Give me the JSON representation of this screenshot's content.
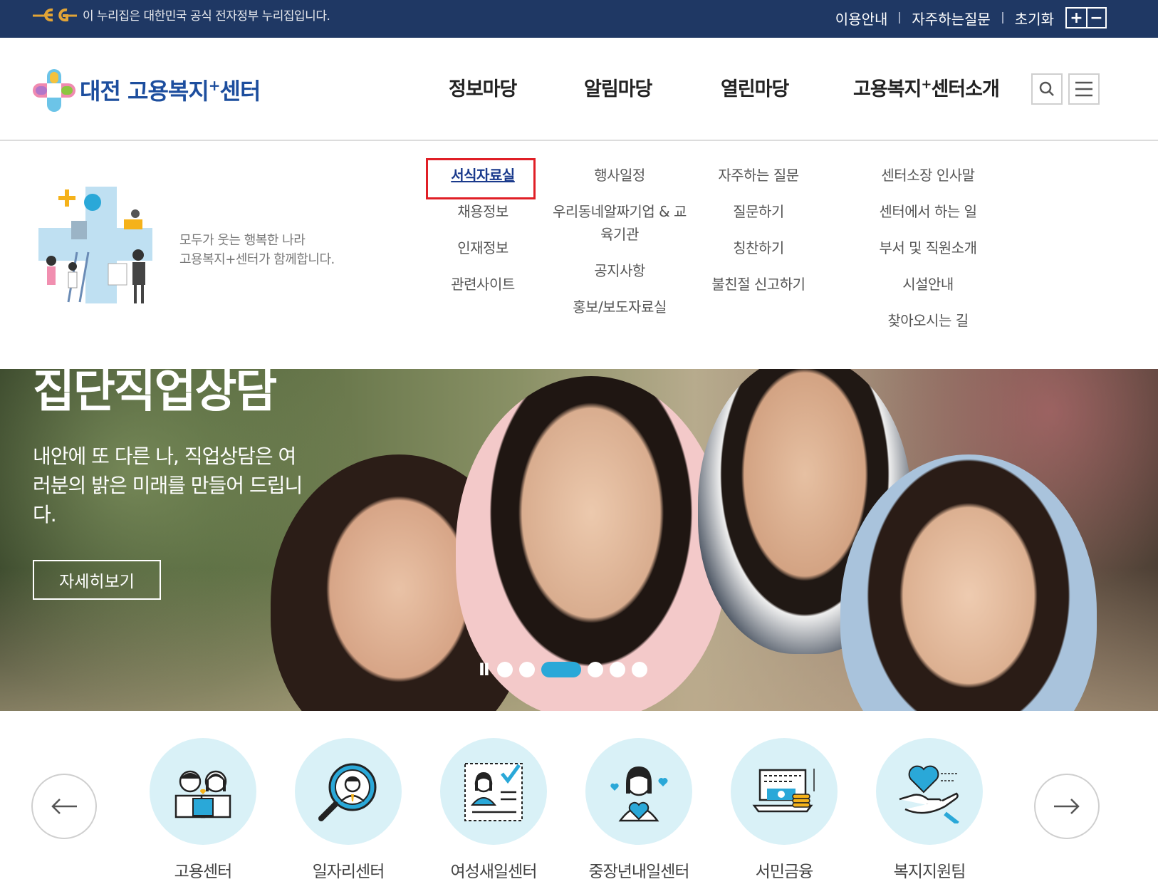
{
  "gov_bar": {
    "notice": "이 누리집은 대한민국 공식 전자정부 누리집입니다.",
    "links": [
      "이용안내",
      "자주하는질문",
      "초기화"
    ],
    "zoom_in": "+",
    "zoom_out": "−"
  },
  "header": {
    "logo_text": "대전 고용복지",
    "logo_plus": "+",
    "logo_suffix": "센터",
    "nav": [
      {
        "label": "정보마당"
      },
      {
        "label": "알림마당"
      },
      {
        "label": "열린마당"
      },
      {
        "label": "고용복지",
        "plus": "+",
        "suffix": "센터소개"
      }
    ]
  },
  "mega_menu": {
    "slogan_line1": "모두가 웃는 행복한 나라",
    "slogan_line2": "고용복지+센터가 함께합니다.",
    "columns": [
      [
        "서식자료실",
        "채용정보",
        "인재정보",
        "관련사이트"
      ],
      [
        "행사일정",
        "우리동네알짜기업 & 교육기관",
        "공지사항",
        "홍보/보도자료실"
      ],
      [
        "자주하는 질문",
        "질문하기",
        "칭찬하기",
        "불친절 신고하기"
      ],
      [
        "센터소장 인사말",
        "센터에서 하는 일",
        "부서 및 직원소개",
        "시설안내",
        "찾아오시는 길"
      ]
    ],
    "active_item": "서식자료실"
  },
  "hero": {
    "title": "집단직업상담",
    "desc": "내안에 또 다른 나, 직업상담은 여러분의 밝은 미래를 만들어 드립니다.",
    "button": "자세히보기",
    "pause": "II",
    "active_slide": 3,
    "slide_count": 6
  },
  "quick_links": [
    {
      "label": "고용센터",
      "icon": "couple-icon"
    },
    {
      "label": "일자리센터",
      "icon": "magnifier-person-icon"
    },
    {
      "label": "여성새일센터",
      "icon": "woman-resume-icon"
    },
    {
      "label": "중장년내일센터",
      "icon": "woman-hearts-icon"
    },
    {
      "label": "서민금융",
      "icon": "coins-laptop-icon"
    },
    {
      "label": "복지지원팀",
      "icon": "hand-heart-icon"
    }
  ],
  "colors": {
    "gov_bar_bg": "#1f3864",
    "brand_blue": "#1d4e9e",
    "highlight_red": "#e01f26",
    "pager_active": "#2aa8d8",
    "quick_circle": "#d9f1f7"
  }
}
